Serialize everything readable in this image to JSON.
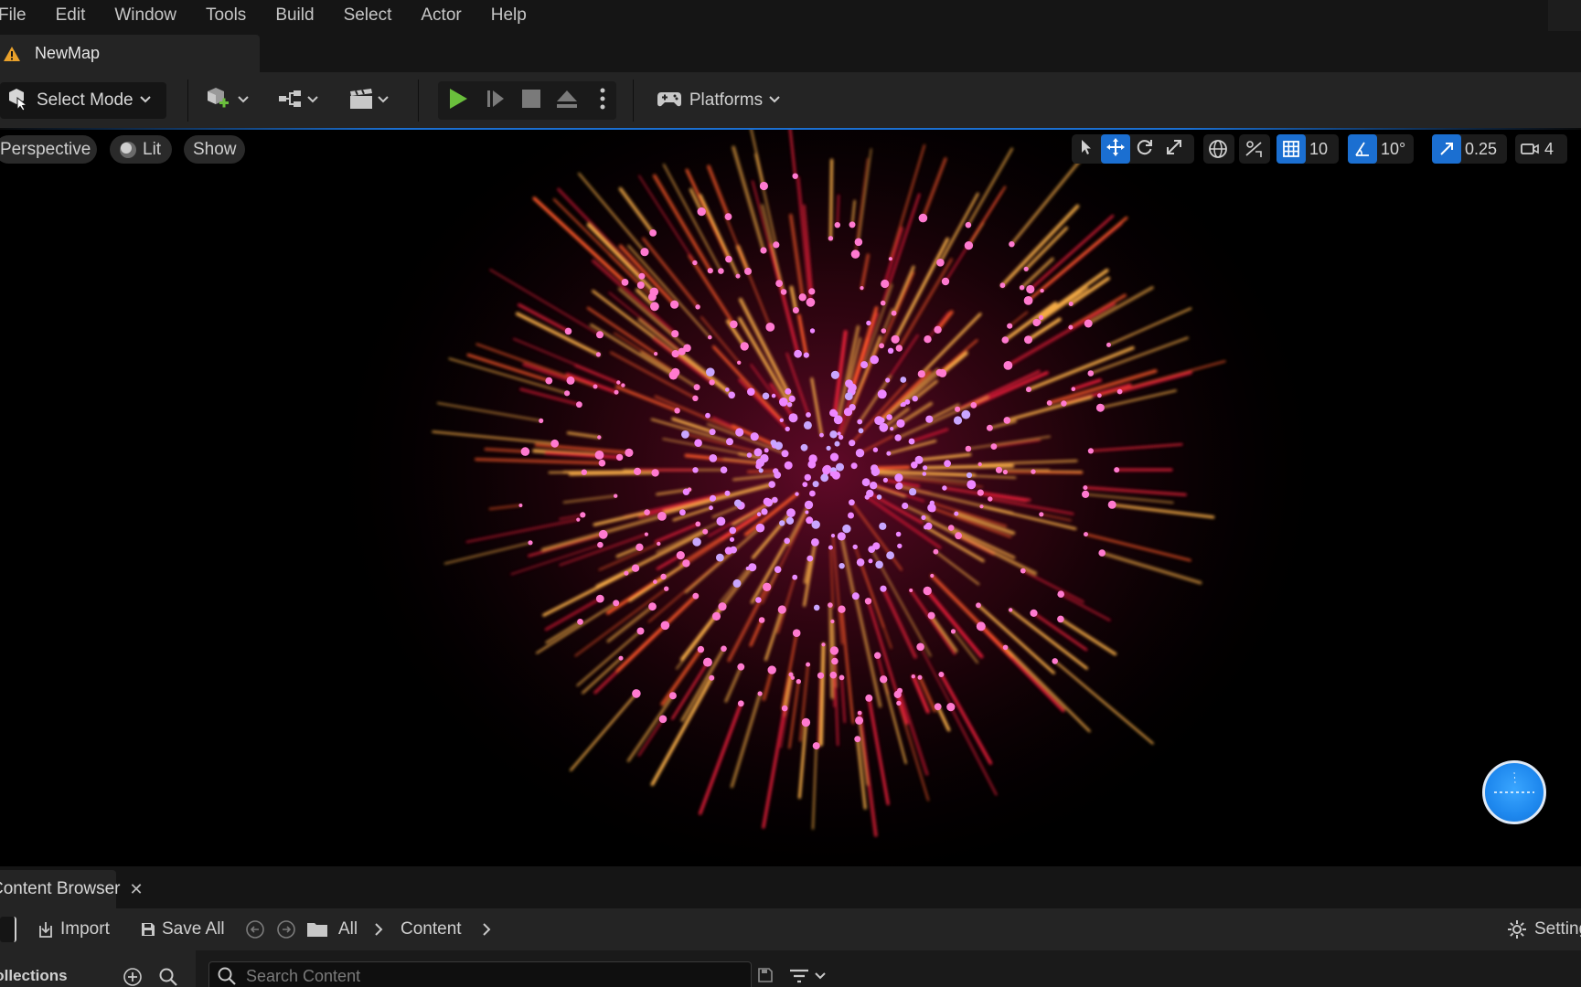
{
  "menu": {
    "items": [
      "File",
      "Edit",
      "Window",
      "Tools",
      "Build",
      "Select",
      "Actor",
      "Help"
    ]
  },
  "level_tab": {
    "label": "NewMap",
    "icon": "warning-icon"
  },
  "toolbar": {
    "select_mode_label": "Select Mode",
    "platforms_label": "Platforms",
    "play_color": "#6abf3c"
  },
  "viewport": {
    "perspective_label": "Perspective",
    "lit_label": "Lit",
    "show_label": "Show",
    "grid_snap_value": "10",
    "rotation_snap_value": "10°",
    "scale_snap_value": "0.25",
    "camera_speed_value": "4",
    "accent_color": "#1b6fd1"
  },
  "content_browser": {
    "tab_label": "Content Browser",
    "import_label": "Import",
    "save_all_label": "Save All",
    "path": [
      "All",
      "Content"
    ],
    "settings_label": "Settings",
    "sources_label": "Collections",
    "search_placeholder": "Search Content"
  }
}
